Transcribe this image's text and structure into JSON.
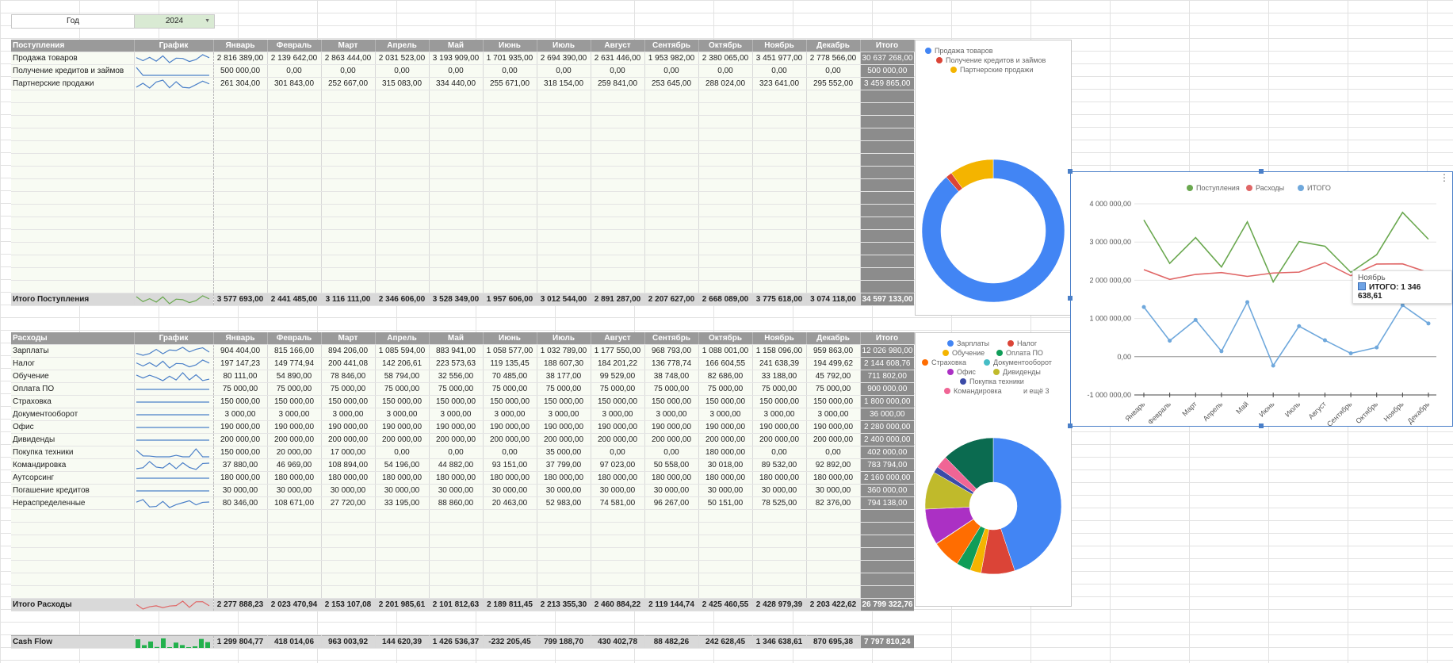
{
  "year": {
    "label": "Год",
    "value": "2024"
  },
  "months": [
    "Январь",
    "Февраль",
    "Март",
    "Апрель",
    "Май",
    "Июнь",
    "Июль",
    "Август",
    "Сентябрь",
    "Октябрь",
    "Ноябрь",
    "Декабрь"
  ],
  "income": {
    "title": "Поступления",
    "graph_label": "График",
    "total_label": "Итого",
    "rows": [
      {
        "name": "Продажа товаров",
        "values": [
          "2 816 389,00",
          "2 139 642,00",
          "2 863 444,00",
          "2 031 523,00",
          "3 193 909,00",
          "1 701 935,00",
          "2 694 390,00",
          "2 631 446,00",
          "1 953 982,00",
          "2 380 065,00",
          "3 451 977,00",
          "2 778 566,00"
        ],
        "total": "30 637 268,00"
      },
      {
        "name": "Получение кредитов и займов",
        "values": [
          "500 000,00",
          "0,00",
          "0,00",
          "0,00",
          "0,00",
          "0,00",
          "0,00",
          "0,00",
          "0,00",
          "0,00",
          "0,00",
          "0,00"
        ],
        "total": "500 000,00"
      },
      {
        "name": "Партнерские продажи",
        "values": [
          "261 304,00",
          "301 843,00",
          "252 667,00",
          "315 083,00",
          "334 440,00",
          "255 671,00",
          "318 154,00",
          "259 841,00",
          "253 645,00",
          "288 024,00",
          "323 641,00",
          "295 552,00"
        ],
        "total": "3 459 865,00"
      }
    ],
    "sum": {
      "name": "Итого Поступления",
      "values": [
        "3 577 693,00",
        "2 441 485,00",
        "3 116 111,00",
        "2 346 606,00",
        "3 528 349,00",
        "1 957 606,00",
        "3 012 544,00",
        "2 891 287,00",
        "2 207 627,00",
        "2 668 089,00",
        "3 775 618,00",
        "3 074 118,00"
      ],
      "total": "34 597 133,00"
    }
  },
  "expense": {
    "title": "Расходы",
    "graph_label": "График",
    "total_label": "Итого",
    "rows": [
      {
        "name": "Зарплаты",
        "values": [
          "904 404,00",
          "815 166,00",
          "894 206,00",
          "1 085 594,00",
          "883 941,00",
          "1 058 577,00",
          "1 032 789,00",
          "1 177 550,00",
          "968 793,00",
          "1 088 001,00",
          "1 158 096,00",
          "959 863,00"
        ],
        "total": "12 026 980,00"
      },
      {
        "name": "Налог",
        "values": [
          "197 147,23",
          "149 774,94",
          "200 441,08",
          "142 206,61",
          "223 573,63",
          "119 135,45",
          "188 607,30",
          "184 201,22",
          "136 778,74",
          "166 604,55",
          "241 638,39",
          "194 499,62"
        ],
        "total": "2 144 608,76"
      },
      {
        "name": "Обучение",
        "values": [
          "80 111,00",
          "54 890,00",
          "78 846,00",
          "58 794,00",
          "32 556,00",
          "70 485,00",
          "38 177,00",
          "99 529,00",
          "38 748,00",
          "82 686,00",
          "33 188,00",
          "45 792,00"
        ],
        "total": "711 802,00"
      },
      {
        "name": "Оплата ПО",
        "values": [
          "75 000,00",
          "75 000,00",
          "75 000,00",
          "75 000,00",
          "75 000,00",
          "75 000,00",
          "75 000,00",
          "75 000,00",
          "75 000,00",
          "75 000,00",
          "75 000,00",
          "75 000,00"
        ],
        "total": "900 000,00"
      },
      {
        "name": "Страховка",
        "values": [
          "150 000,00",
          "150 000,00",
          "150 000,00",
          "150 000,00",
          "150 000,00",
          "150 000,00",
          "150 000,00",
          "150 000,00",
          "150 000,00",
          "150 000,00",
          "150 000,00",
          "150 000,00"
        ],
        "total": "1 800 000,00"
      },
      {
        "name": "Документооборот",
        "values": [
          "3 000,00",
          "3 000,00",
          "3 000,00",
          "3 000,00",
          "3 000,00",
          "3 000,00",
          "3 000,00",
          "3 000,00",
          "3 000,00",
          "3 000,00",
          "3 000,00",
          "3 000,00"
        ],
        "total": "36 000,00"
      },
      {
        "name": "Офис",
        "values": [
          "190 000,00",
          "190 000,00",
          "190 000,00",
          "190 000,00",
          "190 000,00",
          "190 000,00",
          "190 000,00",
          "190 000,00",
          "190 000,00",
          "190 000,00",
          "190 000,00",
          "190 000,00"
        ],
        "total": "2 280 000,00"
      },
      {
        "name": "Дивиденды",
        "values": [
          "200 000,00",
          "200 000,00",
          "200 000,00",
          "200 000,00",
          "200 000,00",
          "200 000,00",
          "200 000,00",
          "200 000,00",
          "200 000,00",
          "200 000,00",
          "200 000,00",
          "200 000,00"
        ],
        "total": "2 400 000,00"
      },
      {
        "name": "Покупка техники",
        "values": [
          "150 000,00",
          "20 000,00",
          "17 000,00",
          "0,00",
          "0,00",
          "0,00",
          "35 000,00",
          "0,00",
          "0,00",
          "180 000,00",
          "0,00",
          "0,00"
        ],
        "total": "402 000,00"
      },
      {
        "name": "Командировка",
        "values": [
          "37 880,00",
          "46 969,00",
          "108 894,00",
          "54 196,00",
          "44 882,00",
          "93 151,00",
          "37 799,00",
          "97 023,00",
          "50 558,00",
          "30 018,00",
          "89 532,00",
          "92 892,00"
        ],
        "total": "783 794,00"
      },
      {
        "name": "Аутсорсинг",
        "values": [
          "180 000,00",
          "180 000,00",
          "180 000,00",
          "180 000,00",
          "180 000,00",
          "180 000,00",
          "180 000,00",
          "180 000,00",
          "180 000,00",
          "180 000,00",
          "180 000,00",
          "180 000,00"
        ],
        "total": "2 160 000,00"
      },
      {
        "name": "Погашение кредитов",
        "values": [
          "30 000,00",
          "30 000,00",
          "30 000,00",
          "30 000,00",
          "30 000,00",
          "30 000,00",
          "30 000,00",
          "30 000,00",
          "30 000,00",
          "30 000,00",
          "30 000,00",
          "30 000,00"
        ],
        "total": "360 000,00"
      },
      {
        "name": "Нераспределенные",
        "values": [
          "80 346,00",
          "108 671,00",
          "27 720,00",
          "33 195,00",
          "88 860,00",
          "20 463,00",
          "52 983,00",
          "74 581,00",
          "96 267,00",
          "50 151,00",
          "78 525,00",
          "82 376,00"
        ],
        "total": "794 138,00"
      }
    ],
    "sum": {
      "name": "Итого Расходы",
      "values": [
        "2 277 888,23",
        "2 023 470,94",
        "2 153 107,08",
        "2 201 985,61",
        "2 101 812,63",
        "2 189 811,45",
        "2 213 355,30",
        "2 460 884,22",
        "2 119 144,74",
        "2 425 460,55",
        "2 428 979,39",
        "2 203 422,62"
      ],
      "total": "26 799 322,76"
    }
  },
  "cashflow": {
    "name": "Cash Flow",
    "values": [
      "1 299 804,77",
      "418 014,06",
      "963 003,92",
      "144 620,39",
      "1 426 536,37",
      "-232 205,45",
      "799 188,70",
      "430 402,78",
      "88 482,26",
      "242 628,45",
      "1 346 638,61",
      "870 695,38"
    ],
    "total": "7 797 810,24"
  },
  "chart_data": [
    {
      "type": "pie",
      "variant": "donut",
      "labels": [
        "Продажа товаров",
        "Получение кредитов и займов",
        "Партнерские продажи"
      ],
      "values": [
        30637268,
        500000,
        3459865
      ],
      "colors": [
        "#4285f4",
        "#db4437",
        "#f4b400"
      ],
      "legend_position": "top"
    },
    {
      "type": "line",
      "categories": [
        "Январь",
        "Февраль",
        "Март",
        "Апрель",
        "Май",
        "Июнь",
        "Июль",
        "Август",
        "Сентябрь",
        "Октябрь",
        "Ноябрь",
        "Декабрь"
      ],
      "series": [
        {
          "name": "Поступления",
          "color": "#6aa84f",
          "values": [
            3577693,
            2441485,
            3116111,
            2346606,
            3528349,
            1957606,
            3012544,
            2891287,
            2207627,
            2668089,
            3775618,
            3074118
          ]
        },
        {
          "name": "Расходы",
          "color": "#e06666",
          "values": [
            2277888.23,
            2023470.94,
            2153107.08,
            2201985.61,
            2101812.63,
            2189811.45,
            2213355.3,
            2460884.22,
            2119144.74,
            2425460.55,
            2428979.39,
            2203422.62
          ]
        },
        {
          "name": "ИТОГО",
          "color": "#6fa8dc",
          "values": [
            1299804.77,
            418014.06,
            963003.92,
            144620.39,
            1426536.37,
            -232205.45,
            799188.7,
            430402.78,
            88482.26,
            242628.45,
            1346638.61,
            870695.38
          ]
        }
      ],
      "y_ticks": [
        "4 000 000,00",
        "3 000 000,00",
        "2 000 000,00",
        "1 000 000,00",
        "0,00",
        "-1 000 000,00"
      ],
      "ylim": [
        -1000000,
        4000000
      ],
      "legend_position": "top",
      "tooltip": {
        "title": "Ноябрь",
        "text": "ИТОГО: 1 346 638,61"
      }
    },
    {
      "type": "pie",
      "variant": "donut",
      "labels": [
        "Зарплаты",
        "Налог",
        "Обучение",
        "Оплата ПО",
        "Страховка",
        "Документооборот",
        "Офис",
        "Дивиденды",
        "Покупка техники",
        "Командировка",
        "и ещё 3"
      ],
      "values": [
        12026980,
        2144608.76,
        711802,
        900000,
        1800000,
        36000,
        2280000,
        2400000,
        402000,
        783794,
        3314138
      ],
      "colors": [
        "#4285f4",
        "#db4437",
        "#f4b400",
        "#0f9d58",
        "#ff6d01",
        "#46bdc6",
        "#ab30c4",
        "#c0ba2b",
        "#3b4ba8",
        "#f06595",
        "#0b6b50"
      ],
      "legend_position": "top",
      "legend_more": "и ещё 3"
    }
  ]
}
